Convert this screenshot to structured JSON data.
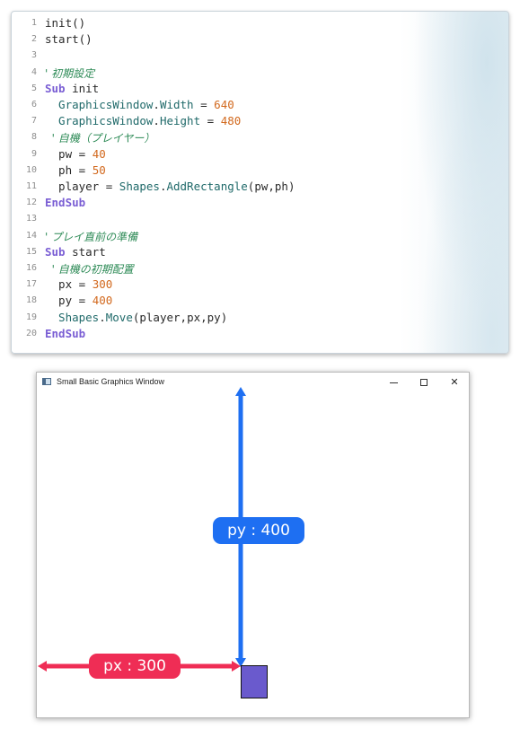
{
  "editor": {
    "lines": [
      {
        "num": "1",
        "tokens": [
          {
            "t": "id",
            "v": "init()"
          }
        ]
      },
      {
        "num": "2",
        "tokens": [
          {
            "t": "id",
            "v": "start()"
          }
        ]
      },
      {
        "num": "3",
        "tokens": []
      },
      {
        "num": "4",
        "tokens": [
          {
            "t": "cm",
            "v": "' 初期設定"
          }
        ]
      },
      {
        "num": "5",
        "tokens": [
          {
            "t": "kw",
            "v": "Sub"
          },
          {
            "t": "id",
            "v": " init"
          }
        ]
      },
      {
        "num": "6",
        "tokens": [
          {
            "t": "obj",
            "v": "  GraphicsWindow"
          },
          {
            "t": "op",
            "v": "."
          },
          {
            "t": "obj",
            "v": "Width"
          },
          {
            "t": "op",
            "v": " = "
          },
          {
            "t": "num",
            "v": "640"
          }
        ]
      },
      {
        "num": "7",
        "tokens": [
          {
            "t": "obj",
            "v": "  GraphicsWindow"
          },
          {
            "t": "op",
            "v": "."
          },
          {
            "t": "obj",
            "v": "Height"
          },
          {
            "t": "op",
            "v": " = "
          },
          {
            "t": "num",
            "v": "480"
          }
        ]
      },
      {
        "num": "8",
        "tokens": [
          {
            "t": "cm",
            "v": "  ' 自機（プレイヤー）"
          }
        ]
      },
      {
        "num": "9",
        "tokens": [
          {
            "t": "id",
            "v": "  pw"
          },
          {
            "t": "op",
            "v": " = "
          },
          {
            "t": "num",
            "v": "40"
          }
        ]
      },
      {
        "num": "10",
        "tokens": [
          {
            "t": "id",
            "v": "  ph"
          },
          {
            "t": "op",
            "v": " = "
          },
          {
            "t": "num",
            "v": "50"
          }
        ]
      },
      {
        "num": "11",
        "tokens": [
          {
            "t": "id",
            "v": "  player"
          },
          {
            "t": "op",
            "v": " = "
          },
          {
            "t": "obj",
            "v": "Shapes"
          },
          {
            "t": "op",
            "v": "."
          },
          {
            "t": "obj",
            "v": "AddRectangle"
          },
          {
            "t": "id",
            "v": "(pw,ph)"
          }
        ]
      },
      {
        "num": "12",
        "tokens": [
          {
            "t": "kw",
            "v": "EndSub"
          }
        ]
      },
      {
        "num": "13",
        "tokens": []
      },
      {
        "num": "14",
        "tokens": [
          {
            "t": "cm",
            "v": "' プレイ直前の準備"
          }
        ]
      },
      {
        "num": "15",
        "tokens": [
          {
            "t": "kw",
            "v": "Sub"
          },
          {
            "t": "id",
            "v": " start"
          }
        ]
      },
      {
        "num": "16",
        "tokens": [
          {
            "t": "cm",
            "v": "  ' 自機の初期配置"
          }
        ]
      },
      {
        "num": "17",
        "tokens": [
          {
            "t": "id",
            "v": "  px"
          },
          {
            "t": "op",
            "v": " = "
          },
          {
            "t": "num",
            "v": "300"
          }
        ]
      },
      {
        "num": "18",
        "tokens": [
          {
            "t": "id",
            "v": "  py"
          },
          {
            "t": "op",
            "v": " = "
          },
          {
            "t": "num",
            "v": "400"
          }
        ]
      },
      {
        "num": "19",
        "tokens": [
          {
            "t": "obj",
            "v": "  Shapes"
          },
          {
            "t": "op",
            "v": "."
          },
          {
            "t": "obj",
            "v": "Move"
          },
          {
            "t": "id",
            "v": "(player,px,py)"
          }
        ]
      },
      {
        "num": "20",
        "tokens": [
          {
            "t": "kw",
            "v": "EndSub"
          }
        ]
      }
    ]
  },
  "graphics_window": {
    "title": "Small Basic Graphics Window",
    "close_glyph": "✕",
    "annotations": {
      "py_label": "py : 400",
      "px_label": "px : 300",
      "py_color": "#1e6ff2",
      "px_color": "#ef2d55"
    },
    "player_color": "#6a5acd"
  },
  "colors": {
    "keyword": "#7a5ed4",
    "number": "#d2691e",
    "comment": "#2e8b57",
    "object": "#206a6a"
  }
}
